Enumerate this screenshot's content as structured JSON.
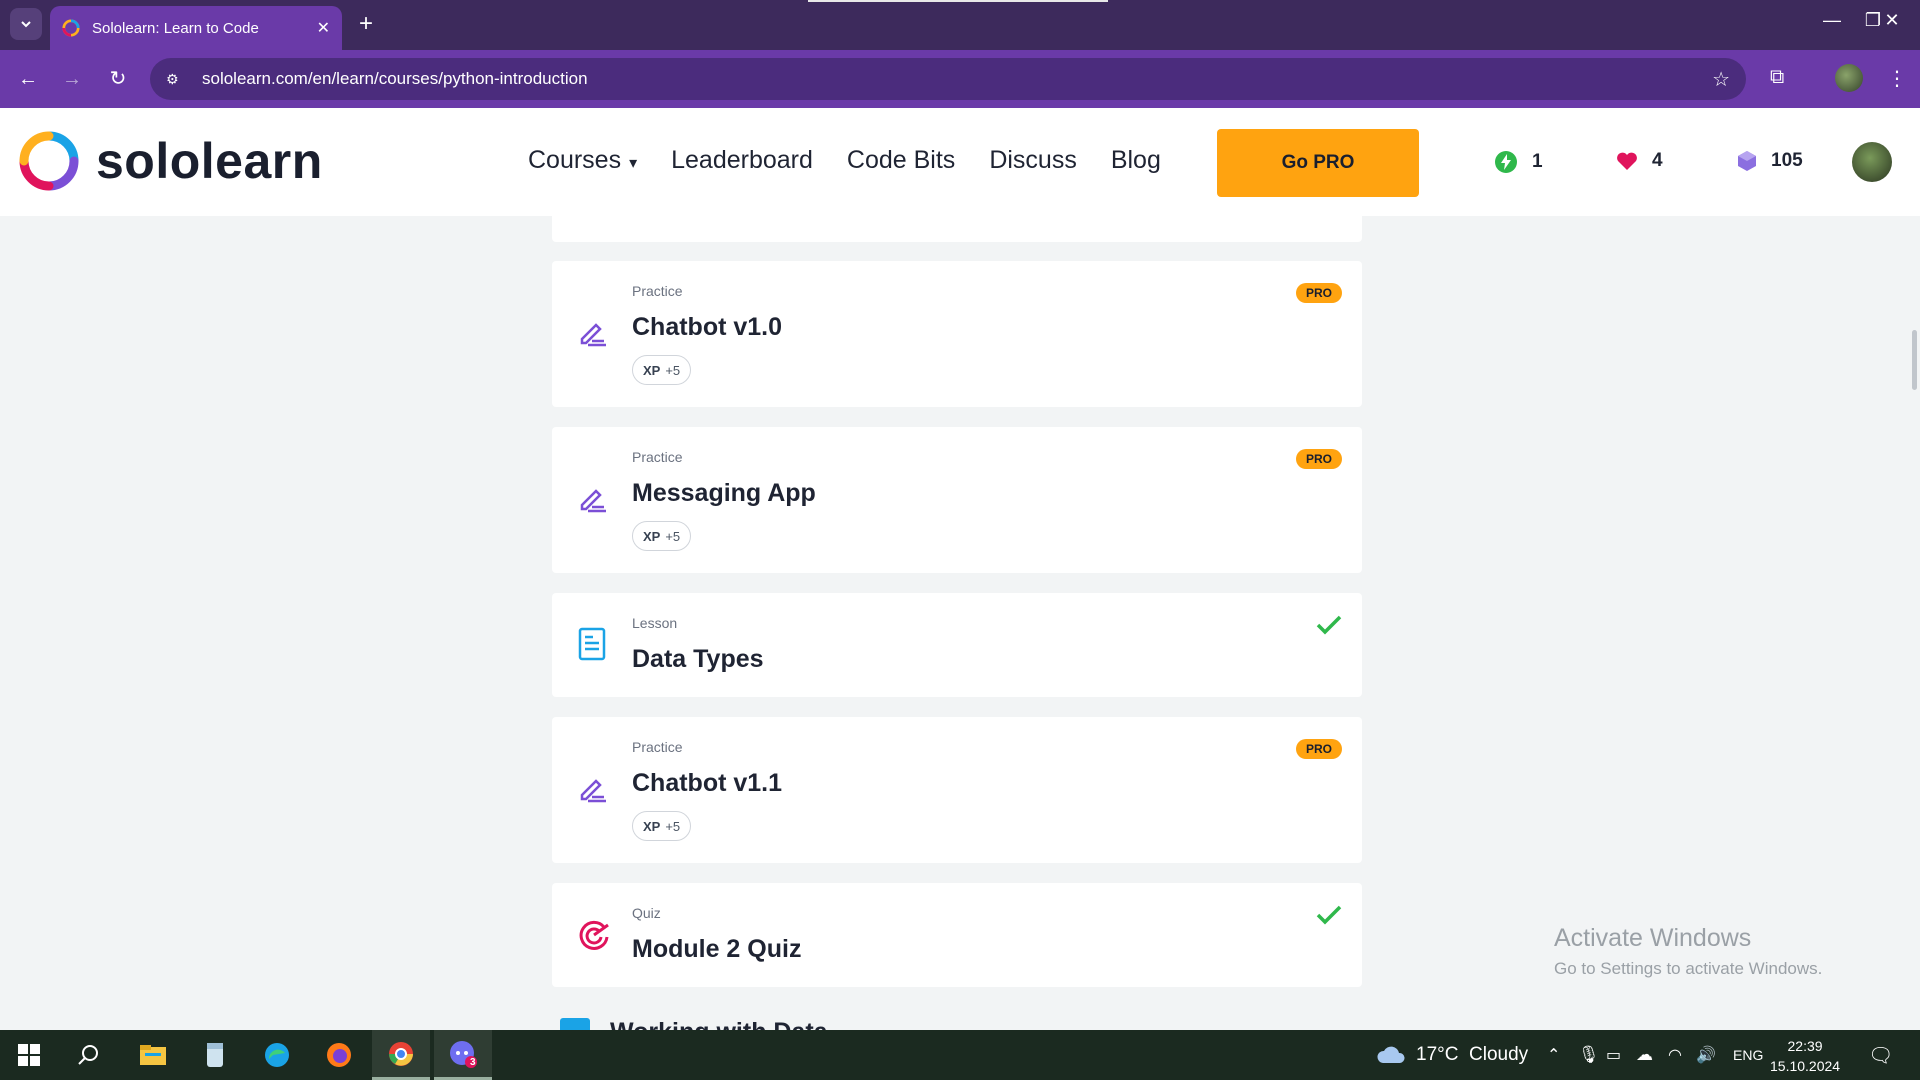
{
  "browser": {
    "tab_title": "Sololearn: Learn to Code",
    "url": "sololearn.com/en/learn/courses/python-introduction"
  },
  "header": {
    "brand": "sololearn",
    "nav": [
      "Courses",
      "Leaderboard",
      "Code Bits",
      "Discuss",
      "Blog"
    ],
    "go_pro": "Go PRO",
    "streak": "1",
    "hearts": "4",
    "bits": "105"
  },
  "items": [
    {
      "kind": "Practice",
      "title": "Chatbot v1.0",
      "xp_label": "XP",
      "xp": "+5",
      "badge": "PRO",
      "icon": "pencil-icon"
    },
    {
      "kind": "Practice",
      "title": "Messaging App",
      "xp_label": "XP",
      "xp": "+5",
      "badge": "PRO",
      "icon": "pencil-icon"
    },
    {
      "kind": "Lesson",
      "title": "Data Types",
      "completed": true,
      "icon": "lesson-icon"
    },
    {
      "kind": "Practice",
      "title": "Chatbot v1.1",
      "xp_label": "XP",
      "xp": "+5",
      "badge": "PRO",
      "icon": "pencil-icon"
    },
    {
      "kind": "Quiz",
      "title": "Module 2 Quiz",
      "completed": true,
      "icon": "target-icon"
    }
  ],
  "next_section": "Working with Data",
  "watermark": {
    "line1": "Activate Windows",
    "line2": "Go to Settings to activate Windows."
  },
  "taskbar": {
    "weather": "17°C  Cloudy",
    "language": "ENG",
    "time": "22:39",
    "date": "15.10.2024",
    "discord_badge": "3"
  },
  "colors": {
    "browser_frame": "#3d2a5c",
    "toolbar": "#6a3aa8",
    "pro_badge": "#ffa310",
    "check": "#2fb84b",
    "pencil": "#7b4fd6",
    "lesson": "#1aa3e6",
    "quiz": "#e0145c"
  }
}
